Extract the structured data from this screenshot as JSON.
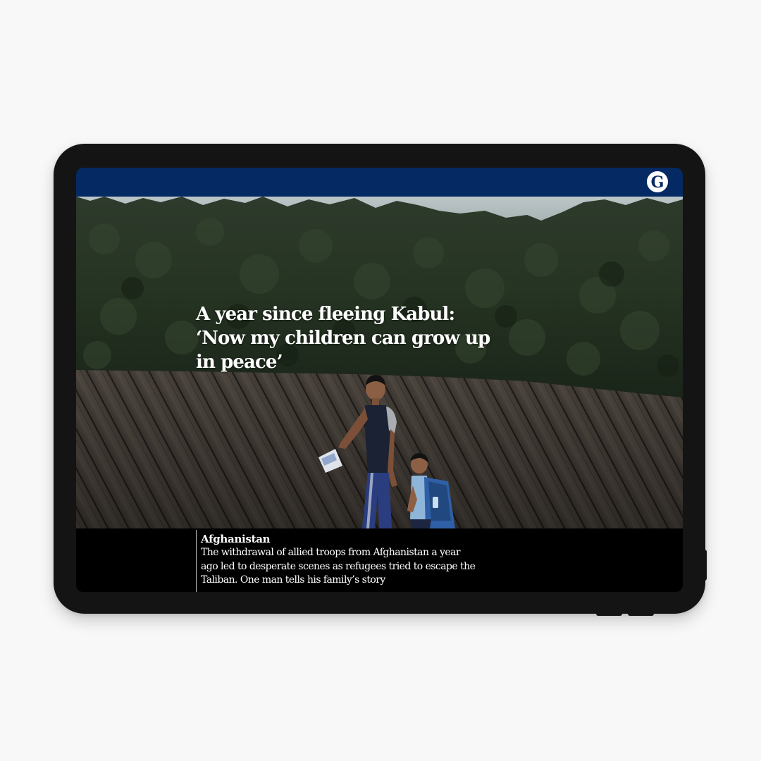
{
  "app": {
    "brand": "The Guardian",
    "logo_letter": "G",
    "colors": {
      "brand_blue": "#052962",
      "page_background": "#f8f8f8",
      "device_frame": "#141414",
      "caption_background": "#000000",
      "text": "#ffffff"
    }
  },
  "article": {
    "headline": "A year since fleeing Kabul: ‘Now my children can grow up in peace’",
    "kicker": "Afghanistan",
    "standfirst": "The withdrawal of allied troops from Afghanistan a year ago led to desperate scenes as refugees tried to escape the Taliban. One man tells his family’s story"
  },
  "image": {
    "subject": "father-and-son-walking-past-wooden-fence-and-hedge"
  }
}
